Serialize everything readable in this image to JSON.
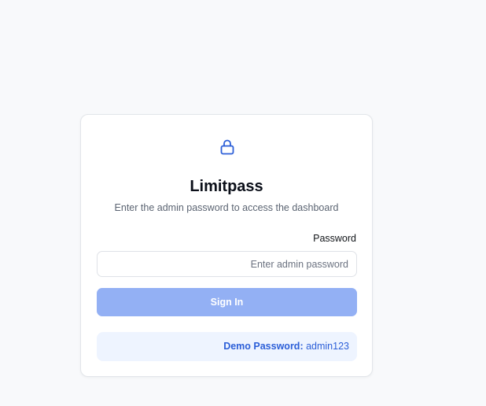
{
  "login": {
    "title": "Limitpass",
    "subtitle": "Enter the admin password to access the dashboard",
    "password_label": "Password",
    "password_placeholder": "Enter admin password",
    "password_value": "",
    "sign_in_label": "Sign In",
    "demo_label": "Demo Password:",
    "demo_value": "admin123",
    "icon": "lock-icon"
  },
  "colors": {
    "accent": "#2c5fd8",
    "button_disabled": "#93b0f4",
    "demo_background": "#eef4ff",
    "page_background": "#f8f9fb"
  }
}
